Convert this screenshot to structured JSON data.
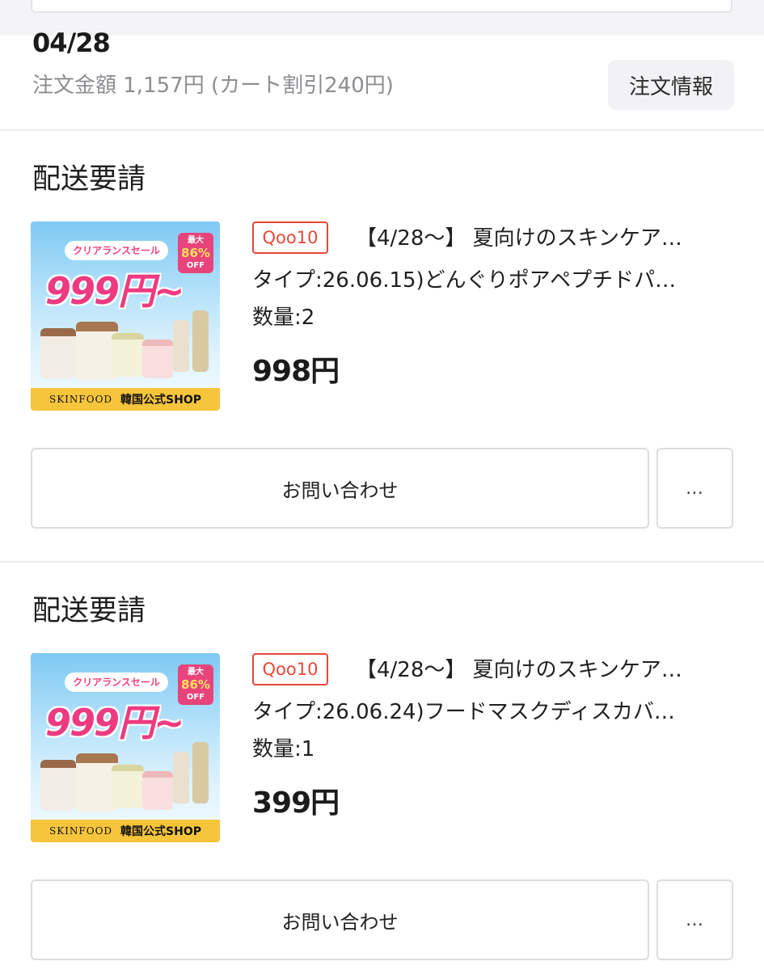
{
  "order": {
    "date": "04/28",
    "amount_text": "注文金額 1,157円 (カート割引240円)",
    "info_button": "注文情報"
  },
  "banner": {
    "ribbon": "クリアランスセール",
    "max_label": "最大",
    "max_pct": "86%",
    "off_label": "OFF",
    "price": "999円~",
    "brand": "SKINFOOD",
    "shop": "韓国公式SHOP"
  },
  "items": [
    {
      "status": "配送要請",
      "shop_tag": "Qoo10",
      "title": "【4/28〜】 夏向けのスキンケア…",
      "type": "タイプ:26.06.15)どんぐりポアペプチドパ…",
      "quantity": "数量:2",
      "price": "998円",
      "inquiry_label": "お問い合わせ",
      "more_label": "…"
    },
    {
      "status": "配送要請",
      "shop_tag": "Qoo10",
      "title": "【4/28〜】 夏向けのスキンケア…",
      "type": "タイプ:26.06.24)フードマスクディスカバ…",
      "quantity": "数量:1",
      "price": "399円",
      "inquiry_label": "お問い合わせ",
      "more_label": "…"
    }
  ],
  "colors": {
    "accent_red": "#e8473a",
    "banner_pink": "#ee3a80",
    "banner_yellow": "#f6c53b"
  }
}
